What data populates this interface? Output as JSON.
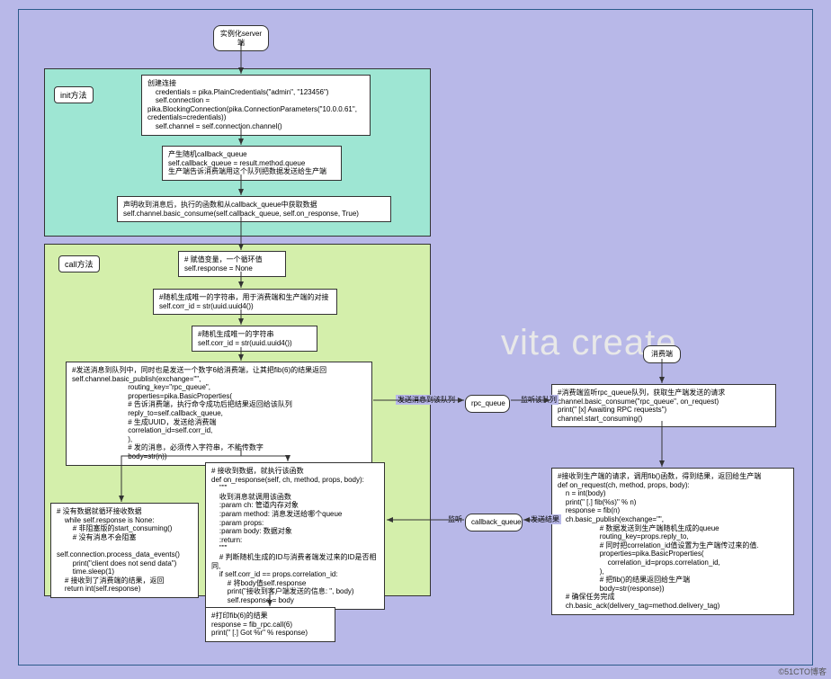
{
  "watermark": "vita create",
  "attribution": "©51CTO博客",
  "top_node": "实例化server端",
  "groups": {
    "init": {
      "title": "init方法"
    },
    "call": {
      "title": "call方法"
    }
  },
  "nodes": {
    "n1": "创建连接\n    credentials = pika.PlainCredentials(\"admin\", \"123456\")\n    self.connection =\npika.BlockingConnection(pika.ConnectionParameters(\"10.0.0.61\",\ncredentials=credentials))\n    self.channel = self.connection.channel()",
    "n2": "产生随机callback_queue\nself.callback_queue = result.method.queue\n生产端告诉消费端用这个队列把数据发送给生产端",
    "n3": "声明收到消息后，执行的函数和从callback_queue中获取数据\nself.channel.basic_consume(self.callback_queue, self.on_response, True)",
    "n4": "# 赋值变量，一个循环值\nself.response = None",
    "n5": "#随机生成唯一的字符串，用于消费端和生产端的对接\nself.corr_id = str(uuid.uuid4())",
    "n6": "#随机生成唯一的字符串\nself.corr_id = str(uuid.uuid4())",
    "n7": "#发送消息到队列中，同时也是发送一个数字6给消费端，让其把fib(6)的结果返回\nself.channel.basic_publish(exchange=\"\",\n                            routing_key=\"rpc_queue\",\n                            properties=pika.BasicProperties(\n                            # 告诉消费端，执行命令成功后把结果返回给该队列\n                            reply_to=self.callback_queue,\n                            # 生成UUID，发送给消费端\n                            correlation_id=self.corr_id,\n                            ),\n                            # 发的消息，必须传入字符串，不能传数字\n                            body=str(n))",
    "n8": "# 没有数据就循环接收数据\n    while self.response is None:\n        # 非阻塞版的start_consuming()\n        # 没有消息不会阻塞\n        self.connection.process_data_events()\n        print(\"client does not send data\")\n        time.sleep(1)\n    # 接收到了消费端的结果，返回\n    return int(self.response)",
    "n9": "# 接收到数据，就执行该函数\ndef on_response(self, ch, method, props, body):\n    \"\"\"\n    收到消息就调用该函数\n    :param ch: 管道内存对象\n    :param method: 消息发送给哪个queue\n    :param props:\n    :param body: 数据对象\n    :return:\n    \"\"\"\n    # 判断随机生成的ID与消费者端发过来的ID是否相同,\n    if self.corr_id == props.correlation_id:\n        # 将body值self.response\n        print(\"接收到客户端发送的信息: \", body)\n        self.response = body",
    "n10": "#打印fib(6)的结果\nresponse = fib_rpc.call(6)\nprint(\" [.] Got %r\" % response)",
    "consumer_title": "消费端",
    "n11": "#消费端监听rpc_queue队列，获取生产端发送的请求\nchannel.basic_consume(\"rpc_queue\", on_request)\nprint(\" [x] Awaiting RPC requests\")\nchannel.start_consuming()",
    "n12": "#接收到生产端的请求，调用fib()函数，得到结果，返回给生产端\ndef on_request(ch, method, props, body):\n    n = int(body)\n    print(\" [.] fib(%s)\" % n)\n    response = fib(n)\n    ch.basic_publish(exchange=\"\",\n                     # 数据发送到生产端随机生成的queue\n                     routing_key=props.reply_to,\n                     # 同时把correlation_id值设置为生产端传过来的值.\n                     properties=pika.BasicProperties(\n                         correlation_id=props.correlation_id,\n                     ),\n                     # 把fib()的结果返回给生产端\n                     body=str(response))\n    # 确保任务完成\n    ch.basic_ack(delivery_tag=method.delivery_tag)"
  },
  "queues": {
    "rpc": "rpc_queue",
    "callback": "callback_queue"
  },
  "edge_labels": {
    "e1": "发送消息到该队列",
    "e2": "监听该队列",
    "e3": "监听",
    "e4": "发送结果"
  }
}
